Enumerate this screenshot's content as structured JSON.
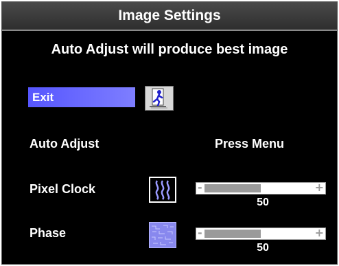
{
  "title": "Image Settings",
  "message": "Auto Adjust will produce best image",
  "exit": {
    "label": "Exit",
    "icon": "exit-person-icon"
  },
  "auto_adjust": {
    "label": "Auto Adjust",
    "value": "Press Menu"
  },
  "pixel_clock": {
    "label": "Pixel Clock",
    "value": "50",
    "level": 0.5,
    "icon": "wave-lines-icon"
  },
  "phase": {
    "label": "Phase",
    "value": "50",
    "level": 0.5,
    "icon": "noise-pattern-icon"
  },
  "colors": {
    "background": "#000000",
    "highlight": "#6a6aff",
    "slider_fill": "#9a9a9a",
    "text": "#ffffff"
  }
}
